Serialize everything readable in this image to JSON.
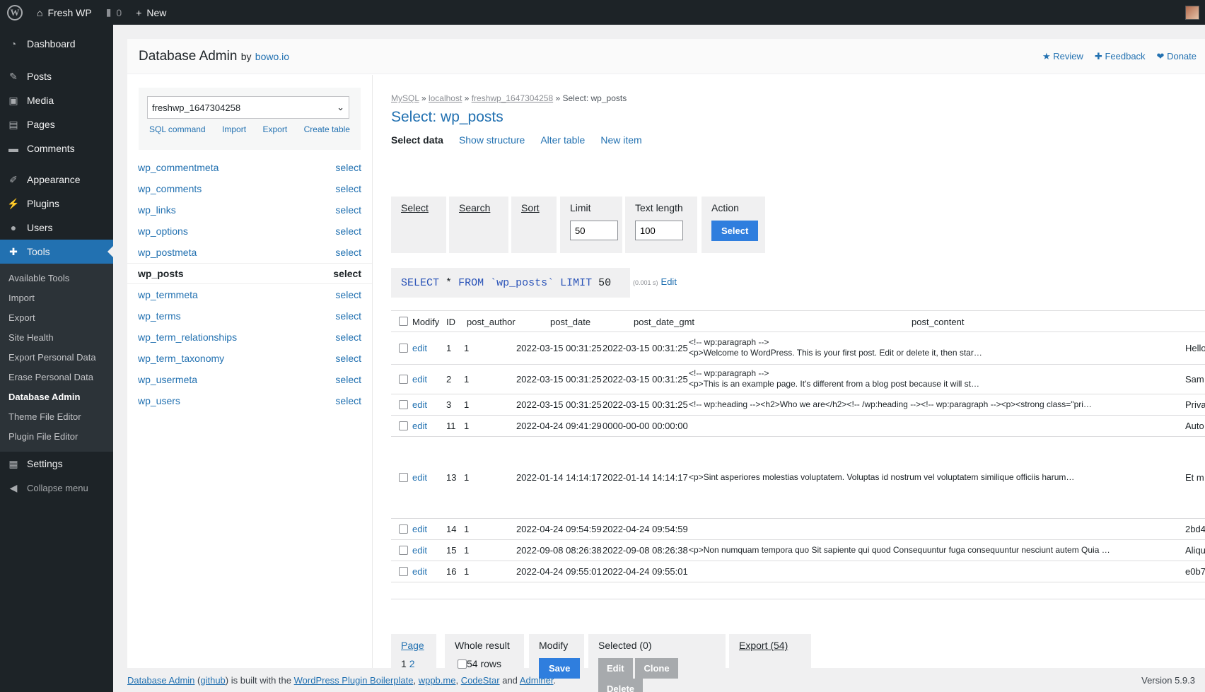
{
  "adminbar": {
    "site_name": "Fresh WP",
    "comments_count": "0",
    "new_label": "New"
  },
  "sidebar": {
    "items": [
      {
        "label": "Dashboard",
        "icon": "dashboard-icon"
      },
      {
        "label": "Posts",
        "icon": "pin-icon"
      },
      {
        "label": "Media",
        "icon": "media-icon"
      },
      {
        "label": "Pages",
        "icon": "page-icon"
      },
      {
        "label": "Comments",
        "icon": "comment-icon"
      },
      {
        "label": "Appearance",
        "icon": "brush-icon"
      },
      {
        "label": "Plugins",
        "icon": "plugin-icon"
      },
      {
        "label": "Users",
        "icon": "user-icon"
      },
      {
        "label": "Tools",
        "icon": "wrench-icon"
      },
      {
        "label": "Settings",
        "icon": "settings-icon"
      }
    ],
    "tools_sub": [
      "Available Tools",
      "Import",
      "Export",
      "Site Health",
      "Export Personal Data",
      "Erase Personal Data",
      "Database Admin",
      "Theme File Editor",
      "Plugin File Editor"
    ],
    "collapse_label": "Collapse menu"
  },
  "header": {
    "title": "Database Admin",
    "by": "by",
    "author": "bowo.io",
    "review": "Review",
    "feedback": "Feedback",
    "donate": "Donate"
  },
  "db": {
    "selected": "freshwp_1647304258",
    "links": [
      "SQL command",
      "Import",
      "Export",
      "Create table"
    ],
    "tables": [
      "wp_commentmeta",
      "wp_comments",
      "wp_links",
      "wp_options",
      "wp_postmeta",
      "wp_posts",
      "wp_termmeta",
      "wp_terms",
      "wp_term_relationships",
      "wp_term_taxonomy",
      "wp_usermeta",
      "wp_users"
    ],
    "select_label": "select"
  },
  "breadcrumb": {
    "mysql": "MySQL",
    "host": "localhost",
    "db": "freshwp_1647304258",
    "current": "Select: wp_posts",
    "sep": "»"
  },
  "title": "Select: wp_posts",
  "tabs": [
    "Select data",
    "Show structure",
    "Alter table",
    "New item"
  ],
  "filters": {
    "select": "Select",
    "search": "Search",
    "sort": "Sort",
    "limit_label": "Limit",
    "limit_value": "50",
    "textlen_label": "Text length",
    "textlen_value": "100",
    "action_label": "Action",
    "action_button": "Select"
  },
  "sql": {
    "p1": "SELECT",
    "p2": "*",
    "p3": "FROM",
    "p4": "`wp_posts`",
    "p5": "LIMIT",
    "p6": "50",
    "time": "(0.001 s)",
    "edit": "Edit"
  },
  "grid": {
    "headers": {
      "modify": "Modify",
      "id": "ID",
      "author": "post_author",
      "date": "post_date",
      "gmt": "post_date_gmt",
      "content": "post_content"
    },
    "edit_label": "edit",
    "rows": [
      {
        "id": "1",
        "author": "1",
        "date": "2022-03-15 00:31:25",
        "gmt": "2022-03-15 00:31:25",
        "content1": "<!-- wp:paragraph -->",
        "content2": "<p>Welcome to WordPress. This is your first post. Edit or delete it, then star…",
        "title": "Hello"
      },
      {
        "id": "2",
        "author": "1",
        "date": "2022-03-15 00:31:25",
        "gmt": "2022-03-15 00:31:25",
        "content1": "<!-- wp:paragraph -->",
        "content2": "<p>This is an example page. It's different from a blog post because it will st…",
        "title": "Sam"
      },
      {
        "id": "3",
        "author": "1",
        "date": "2022-03-15 00:31:25",
        "gmt": "2022-03-15 00:31:25",
        "content1": "<!-- wp:heading --><h2>Who we are</h2><!-- /wp:heading --><!-- wp:paragraph --><p><strong class=\"pri…",
        "content2": "",
        "title": "Priva"
      },
      {
        "id": "11",
        "author": "1",
        "date": "2022-04-24 09:41:29",
        "gmt": "0000-00-00 00:00:00",
        "content1": "",
        "content2": "",
        "title": "Auto"
      },
      {
        "id": "13",
        "author": "1",
        "date": "2022-01-14 14:14:17",
        "gmt": "2022-01-14 14:14:17",
        "content1": "<p>Sint asperiores molestias voluptatem. Voluptas id nostrum vel voluptatem similique officiis harum…",
        "content2": "",
        "title": "Et m"
      },
      {
        "id": "14",
        "author": "1",
        "date": "2022-04-24 09:54:59",
        "gmt": "2022-04-24 09:54:59",
        "content1": "",
        "content2": "",
        "title": "2bd4"
      },
      {
        "id": "15",
        "author": "1",
        "date": "2022-09-08 08:26:38",
        "gmt": "2022-09-08 08:26:38",
        "content1": "<p>Non numquam tempora quo Sit sapiente qui quod Consequuntur fuga consequuntur nesciunt autem Quia …",
        "content2": "",
        "title": "Aliqu"
      },
      {
        "id": "16",
        "author": "1",
        "date": "2022-04-24 09:55:01",
        "gmt": "2022-04-24 09:55:01",
        "content1": "",
        "content2": "",
        "title": "e0b7"
      }
    ]
  },
  "bottom": {
    "page_label": "Page",
    "page_current": "1",
    "page_next": "2",
    "whole_label": "Whole result",
    "rows_label": "54 rows",
    "modify_label": "Modify",
    "save": "Save",
    "selected_label": "Selected (0)",
    "edit": "Edit",
    "clone": "Clone",
    "delete": "Delete",
    "export": "Export (54)"
  },
  "footer": {
    "l1": "Database Admin",
    "l2": "github",
    "t1": " is built with the ",
    "l3": "WordPress Plugin Boilerplate",
    "l4": "wppb.me",
    "l5": "CodeStar",
    "t2": " and ",
    "l6": "Adminer",
    "version": "Version 5.9.3"
  }
}
